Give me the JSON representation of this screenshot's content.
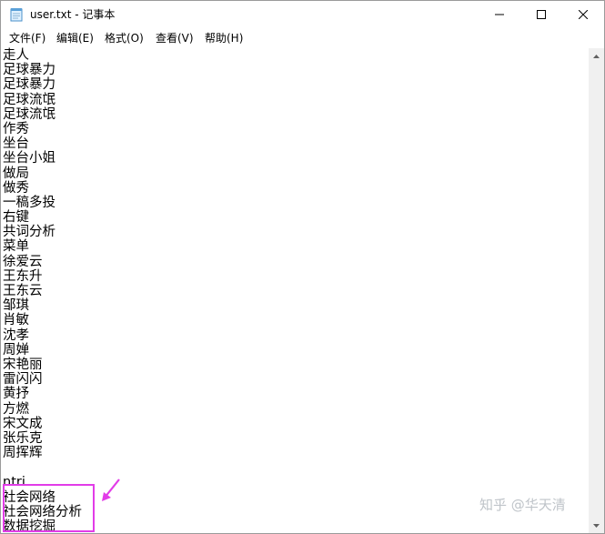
{
  "window": {
    "title": "user.txt - 记事本",
    "minimize_glyph": "—",
    "maximize_glyph": "☐",
    "close_glyph": "✕"
  },
  "menu": [
    {
      "label": "文件(F)"
    },
    {
      "label": "编辑(E)"
    },
    {
      "label": "格式(O)"
    },
    {
      "label": "查看(V)"
    },
    {
      "label": "帮助(H)"
    }
  ],
  "document": {
    "lines": [
      "走人",
      "足球暴力",
      "足球暴力",
      "足球流氓",
      "足球流氓",
      "作秀",
      "坐台",
      "坐台小姐",
      "做局",
      "做秀",
      "一稿多投",
      "右键",
      "共词分析",
      "菜单",
      "徐爱云",
      "王东升",
      "王东云",
      "邹琪",
      "肖敏",
      "沈孝",
      "周婵",
      "宋艳丽",
      "雷闪闪",
      "黄抒",
      "方燃",
      "宋文成",
      "张乐克",
      "周挥辉",
      "",
      "ntri",
      "社会网络",
      "社会网络分析",
      "数据挖掘"
    ]
  },
  "annotation": {
    "color": "#e23ce8"
  },
  "watermark": {
    "text": "知乎 @华天清"
  },
  "icons": {
    "app": "notepad-icon",
    "scroll_up": "scroll-up-arrow-icon",
    "scroll_down": "scroll-down-arrow-icon"
  }
}
